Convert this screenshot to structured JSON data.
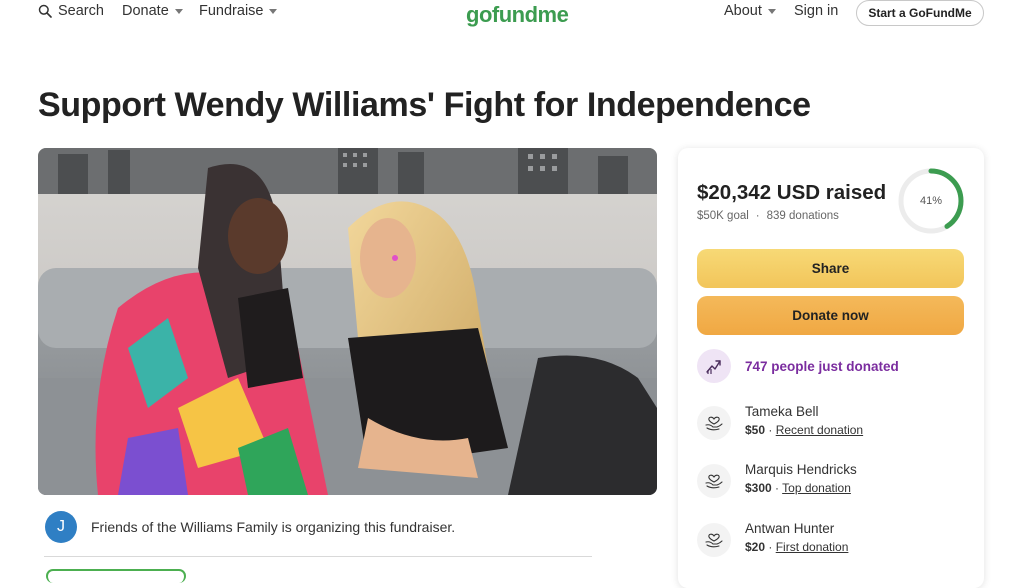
{
  "header": {
    "search_label": "Search",
    "donate_label": "Donate",
    "fundraise_label": "Fundraise",
    "logo_text": "gofundme",
    "about_label": "About",
    "signin_label": "Sign in",
    "start_label": "Start a GoFundMe"
  },
  "campaign": {
    "title": "Support Wendy Williams' Fight for Independence",
    "organizer_initial": "J",
    "organizer_text": "Friends of the Williams Family is organizing this fundraiser."
  },
  "progress": {
    "raised": "$20,342 USD raised",
    "goal": "$50K goal",
    "separator": "·",
    "donations": "839 donations",
    "percent_label": "41%",
    "percent_value": 0.41
  },
  "actions": {
    "share_label": "Share",
    "donate_label": "Donate now"
  },
  "activity": {
    "trend_text": "747 people just donated"
  },
  "donors": [
    {
      "name": "Tameka Bell",
      "amount": "$50",
      "sep": " · ",
      "tag": "Recent donation"
    },
    {
      "name": "Marquis Hendricks",
      "amount": "$300",
      "sep": " · ",
      "tag": "Top donation"
    },
    {
      "name": "Antwan Hunter",
      "amount": "$20",
      "sep": " · ",
      "tag": "First donation"
    }
  ],
  "colors": {
    "brand_green": "#3c9c50",
    "share_yellow": "#f2c55a",
    "donate_orange": "#f0a843",
    "trend_purple": "#7b2d9f",
    "avatar_blue": "#2f7fc4"
  },
  "icons": [
    "search-icon",
    "chevron-down-icon",
    "trending-up-icon",
    "heart-hands-icon"
  ]
}
